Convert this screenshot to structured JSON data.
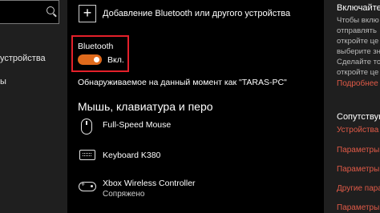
{
  "sidebar": {
    "search_icon": "search-icon",
    "items": [
      {
        "label": "устройства"
      },
      {
        "label": "ы"
      }
    ]
  },
  "main": {
    "add_device_label": "Добавление Bluetooth или другого устройства",
    "add_icon": "plus-icon",
    "bluetooth": {
      "title": "Bluetooth",
      "toggle_state": "Вкл.",
      "toggle_color": "#e06a1c",
      "discoverable_text": "Обнаруживаемое на данный момент как \"TARAS-PC\""
    },
    "section_title": "Мышь, клавиатура и перо",
    "devices": [
      {
        "name": "Full-Speed Mouse",
        "status": "",
        "icon": "mouse-icon"
      },
      {
        "name": "Keyboard K380",
        "status": "",
        "icon": "keyboard-icon"
      },
      {
        "name": "Xbox Wireless Controller",
        "status": "Сопряжено",
        "icon": "gamepad-icon"
      }
    ]
  },
  "right_panel": {
    "heading1": "Включайте Bluet",
    "paragraph_lines": [
      "Чтобы вклю",
      "отправлять",
      "откройте це",
      "выберите зн",
      "Сделайте то",
      "откройте це"
    ],
    "link1": "Подробнее о п",
    "heading2": "Сопутствующ",
    "links": [
      "Устройства и п",
      "Параметры зв",
      "Параметры ди",
      "Другие парам",
      "Параметры"
    ],
    "link_color": "#e05a47"
  }
}
